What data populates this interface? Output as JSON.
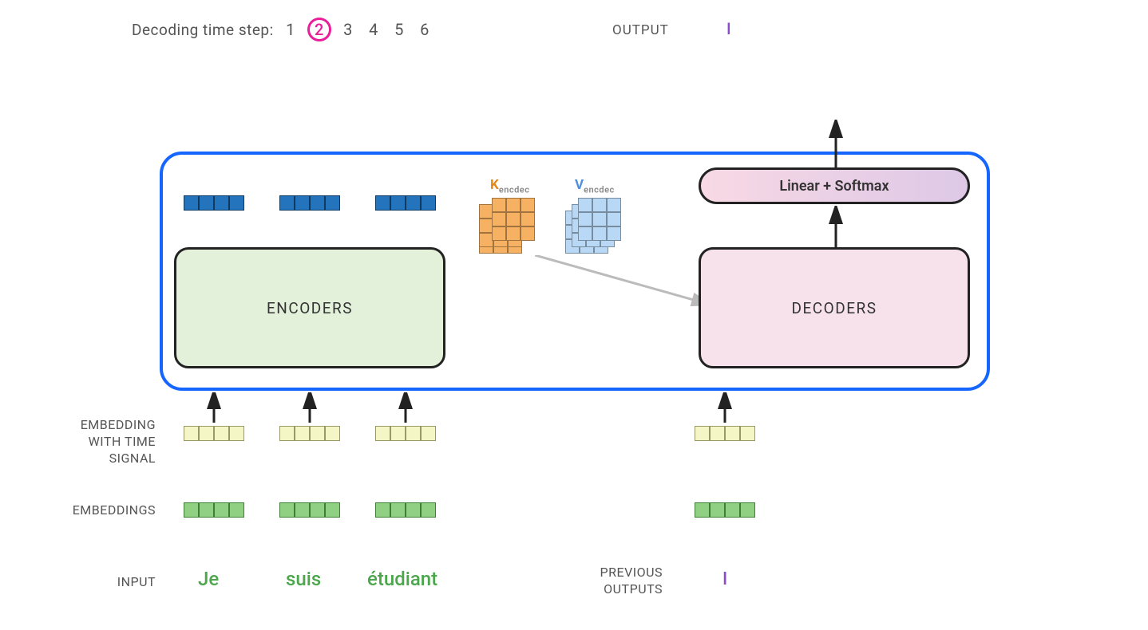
{
  "header": {
    "timestep_label": "Decoding time step:",
    "steps": [
      "1",
      "2",
      "3",
      "4",
      "5",
      "6"
    ],
    "active_step_index": 1,
    "output_label": "OUTPUT",
    "output_token": "I"
  },
  "blocks": {
    "encoders_label": "ENCODERS",
    "decoders_label": "DECODERS",
    "linear_softmax_label": "Linear + Softmax"
  },
  "kv": {
    "k_letter": "K",
    "k_sub": "encdec",
    "v_letter": "V",
    "v_sub": "encdec"
  },
  "left_labels": {
    "embedding_time_1": "EMBEDDING",
    "embedding_time_2": "WITH TIME",
    "embedding_time_3": "SIGNAL",
    "embeddings": "EMBEDDINGS",
    "input": "INPUT",
    "previous_outputs_1": "PREVIOUS",
    "previous_outputs_2": "OUTPUTS"
  },
  "inputs": {
    "tokens": [
      "Je",
      "suis",
      "étudiant"
    ],
    "previous_output_token": "I"
  },
  "colors": {
    "brand_blue": "#1565ff",
    "highlight_pink": "#e91e9a",
    "k_orange": "#e38b1a",
    "v_blue": "#4f90d8",
    "token_green": "#4ca64c",
    "token_purple": "#8a4cc8"
  }
}
